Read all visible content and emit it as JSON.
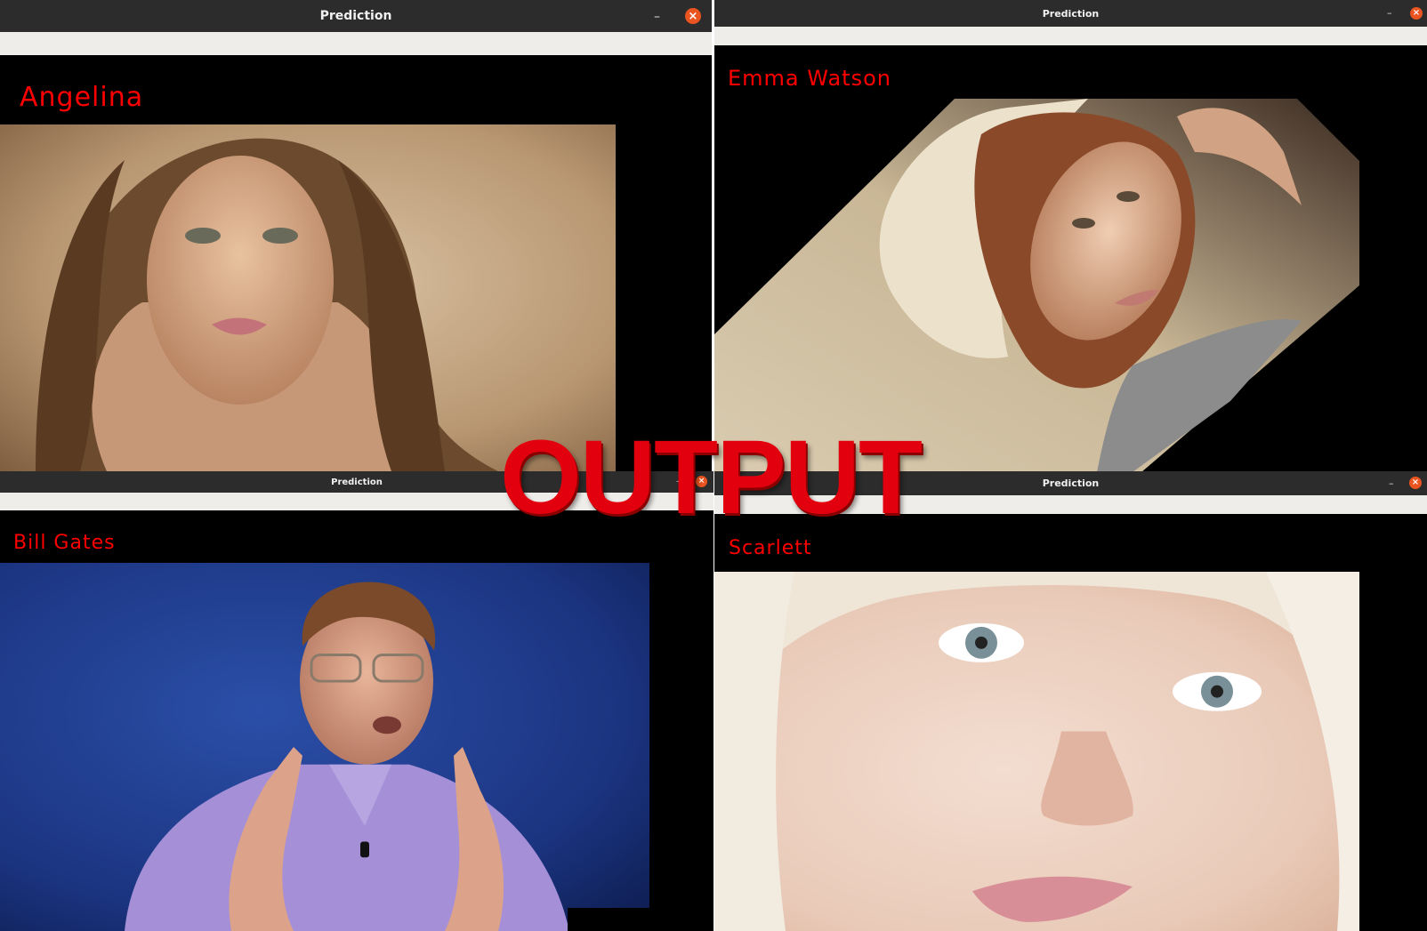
{
  "windows": {
    "angelina": {
      "title": "Prediction",
      "label": "Angelina",
      "minimize": "–",
      "close": "×"
    },
    "emma": {
      "title": "Prediction",
      "label": "Emma Watson",
      "minimize": "–",
      "close": "×"
    },
    "bill": {
      "title": "Prediction",
      "label": "Bill Gates",
      "minimize": "–",
      "close": "×"
    },
    "scarlett": {
      "title": "Prediction",
      "label": "Scarlett",
      "minimize": "–",
      "close": "×"
    }
  },
  "overlay": {
    "text": "OUTPUT"
  },
  "colors": {
    "label_red": "#ff0000",
    "banner_red": "#e3000e",
    "titlebar": "#2c2c2c",
    "toolbar": "#efedea",
    "close": "#e95420"
  }
}
